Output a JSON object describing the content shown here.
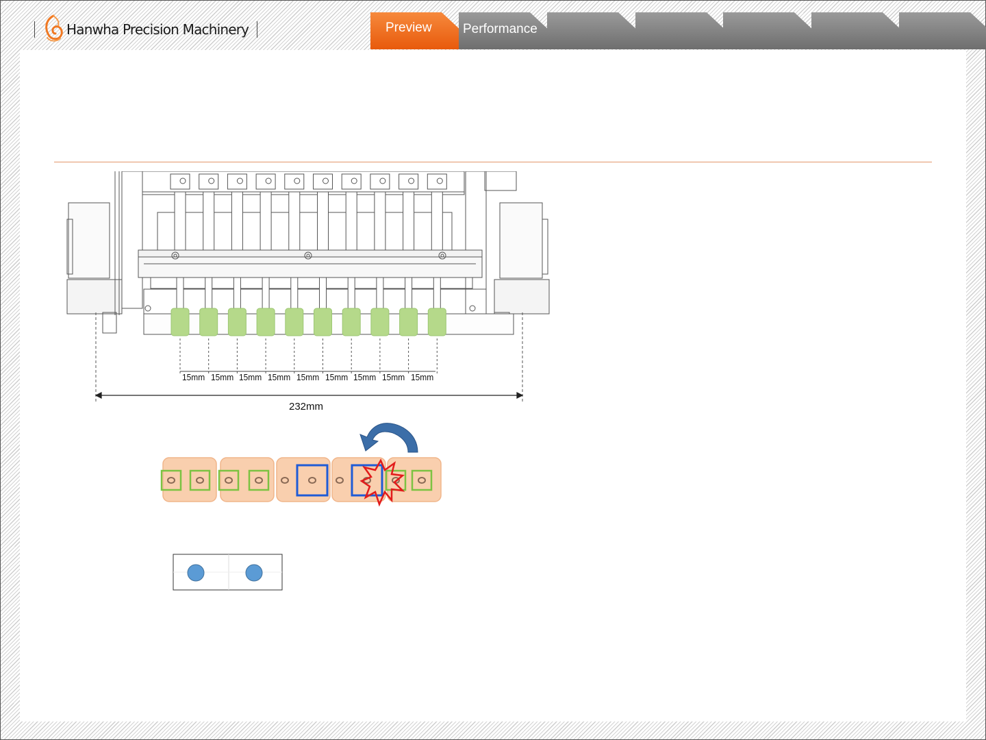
{
  "header": {
    "brand": "Hanwha Precision Machinery",
    "logo_icon": "hanwha-flame-logo",
    "accent_color": "#f07822"
  },
  "tabs": [
    {
      "label": "Preview",
      "active": true
    },
    {
      "label": "Performance",
      "active": false
    },
    {
      "label": "",
      "active": false
    },
    {
      "label": "",
      "active": false
    },
    {
      "label": "",
      "active": false
    },
    {
      "label": "",
      "active": false
    },
    {
      "label": "",
      "active": false
    }
  ],
  "figure": {
    "nozzle_count": 10,
    "nozzle_color": "#b5d98a",
    "pitch_labels": [
      "15mm",
      "15mm",
      "15mm",
      "15mm",
      "15mm",
      "15mm",
      "15mm",
      "15mm",
      "15mm"
    ],
    "total_width_label": "232mm"
  },
  "collision_diagram": {
    "feeder_color": "#f9cfae",
    "pocket_green": "#7cc242",
    "pocket_blue": "#1f5bd6",
    "arrow_color": "#3c6ea8",
    "burst_icon": "collision-burst-icon"
  },
  "legend": {
    "dot_color": "#5b9bd5",
    "dot_count": 2
  }
}
